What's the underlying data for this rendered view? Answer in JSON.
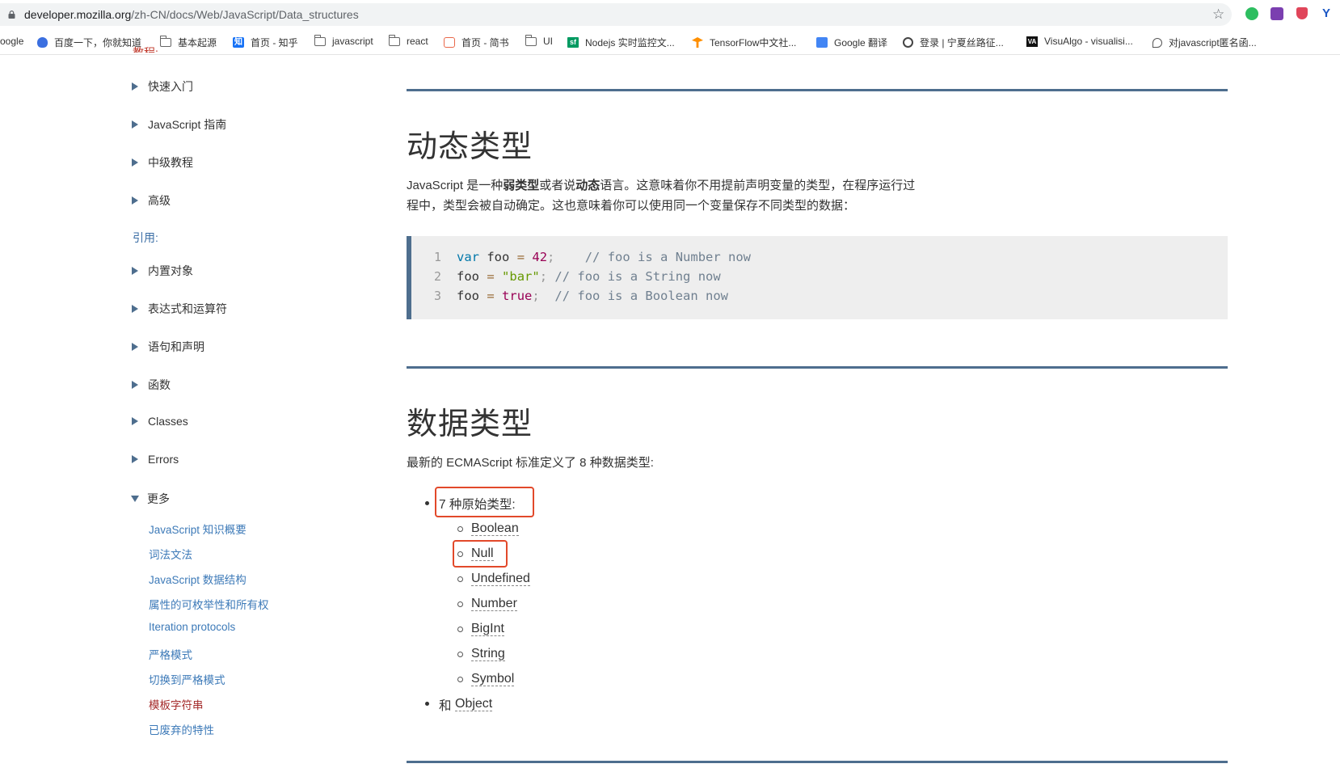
{
  "browser": {
    "url_host": "developer.mozilla.org",
    "url_path": "/zh-CN/docs/Web/JavaScript/Data_structures",
    "bookmarks": [
      "oogle",
      "百度一下，你就知道",
      "基本起源",
      "首页 - 知乎",
      "javascript",
      "react",
      "首页 - 简书",
      "UI",
      "Nodejs 实时监控文...",
      "TensorFlow中文社...",
      "Google 翻译",
      "登录 | 宁夏丝路征...",
      "VisuAlgo - visualisi...",
      "对javascript匿名函..."
    ]
  },
  "sidebar": {
    "cut_heading": "教程:",
    "tutorial_items": [
      "快速入门",
      "JavaScript 指南",
      "中级教程",
      "高级"
    ],
    "reference_label": "引用:",
    "reference_items": [
      "内置对象",
      "表达式和运算符",
      "语句和声明",
      "函数",
      "Classes",
      "Errors"
    ],
    "more_label": "更多",
    "more_links": [
      "JavaScript 知识概要",
      "词法文法",
      "JavaScript 数据结构",
      "属性的可枚举性和所有权",
      "Iteration protocols",
      "严格模式",
      "切换到严格模式",
      "模板字符串",
      "已废弃的特性"
    ]
  },
  "main": {
    "section1_title": "动态类型",
    "section1_para_a": "JavaScript 是一种",
    "section1_para_b": "弱类型",
    "section1_para_c": "或者说",
    "section1_para_d": "动态",
    "section1_para_e": "语言。这意味着你不用提前声明变量的类型，在程序运行过",
    "section1_para_f": "程中，类型会被自动确定。这也意味着你可以使用同一个变量保存不同类型的数据：",
    "code": {
      "line_numbers": [
        "1",
        "2",
        "3"
      ],
      "l1_kw": "var",
      "l1_id": "foo",
      "l1_op": "=",
      "l1_val": "42",
      "l1_semi": ";",
      "l1_cmt": "// foo is a Number now",
      "l2_id": "foo",
      "l2_op": "=",
      "l2_val": "\"bar\"",
      "l2_semi": ";",
      "l2_cmt": "// foo is a String now",
      "l3_id": "foo",
      "l3_op": "=",
      "l3_val": "true",
      "l3_semi": ";",
      "l3_cmt": "// foo is a Boolean now"
    },
    "section2_title": "数据类型",
    "section2_intro": "最新的 ECMAScript 标准定义了 8 种数据类型:",
    "primitive_heading": "7 种原始类型:",
    "primitives": [
      "Boolean",
      "Null",
      "Undefined",
      "Number",
      "BigInt",
      "String",
      "Symbol"
    ],
    "object_prefix": "和",
    "object_link": "Object"
  },
  "colors": {
    "rule": "#4e6e8e",
    "highlight_box": "#e2492a",
    "current_link": "#a42b2b"
  }
}
